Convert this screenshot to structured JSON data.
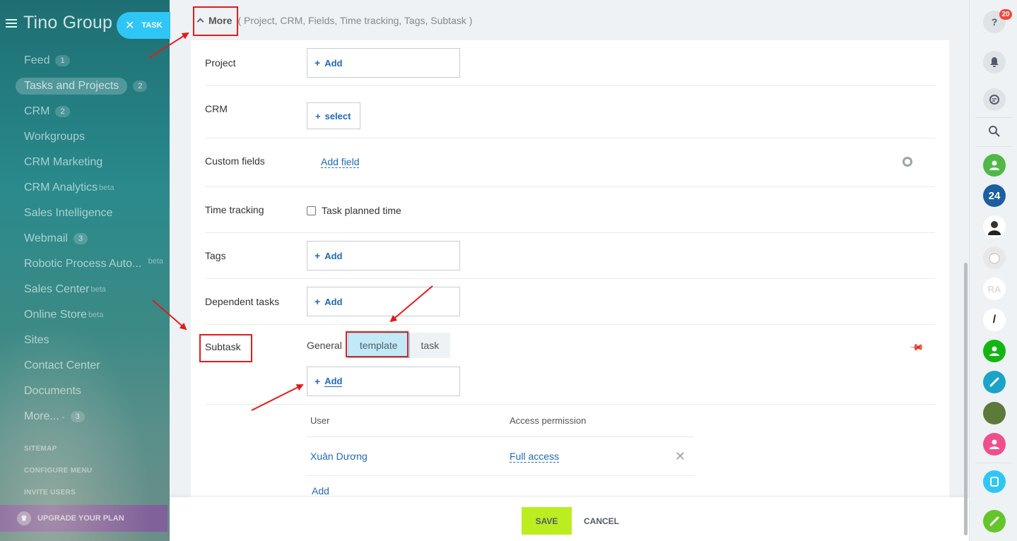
{
  "sidebar": {
    "brand": "Tino Group",
    "task_button": "TASK",
    "items": [
      {
        "label": "Feed",
        "counter": "1"
      },
      {
        "label": "Tasks and Projects",
        "counter": "2"
      },
      {
        "label": "CRM",
        "counter": "2"
      },
      {
        "label": "Workgroups"
      },
      {
        "label": "CRM Marketing"
      },
      {
        "label": "CRM Analytics",
        "beta": "beta"
      },
      {
        "label": "Sales Intelligence"
      },
      {
        "label": "Webmail",
        "counter": "3"
      },
      {
        "label": "Robotic Process Auto...",
        "beta": "beta"
      },
      {
        "label": "Sales Center",
        "beta": "beta"
      },
      {
        "label": "Online Store",
        "beta": "beta"
      },
      {
        "label": "Sites"
      },
      {
        "label": "Contact Center"
      },
      {
        "label": "Documents"
      },
      {
        "label": "More...",
        "suffix": "-",
        "counter": "3"
      }
    ],
    "small_links": [
      "SITEMAP",
      "CONFIGURE MENU",
      "INVITE USERS"
    ],
    "upgrade": "UPGRADE YOUR PLAN"
  },
  "more_section": {
    "toggle_label": "More",
    "hint": "( Project,  CRM,  Fields,  Time tracking,  Tags,  Subtask )"
  },
  "fields": {
    "project": {
      "label": "Project",
      "add": "Add"
    },
    "crm": {
      "label": "CRM",
      "select": "select"
    },
    "custom_fields": {
      "label": "Custom fields",
      "add_field": "Add field"
    },
    "time_tracking": {
      "label": "Time tracking",
      "checkbox_label": "Task planned time"
    },
    "tags": {
      "label": "Tags",
      "add": "Add"
    },
    "dependent": {
      "label": "Dependent tasks",
      "add": "Add"
    },
    "subtask": {
      "label": "Subtask",
      "mode_label": "General",
      "modes": [
        "template",
        "task"
      ],
      "selected": "template",
      "add": "Add"
    }
  },
  "access_table": {
    "headers": [
      "User",
      "Access permission"
    ],
    "rows": [
      {
        "user": "Xuân Dương",
        "permission": "Full access"
      }
    ],
    "add": "Add"
  },
  "footer": {
    "save": "SAVE",
    "cancel": "CANCEL"
  },
  "right_rail": {
    "notifications_count": "20",
    "icons": [
      "help-icon",
      "bell-icon",
      "chat-icon",
      "search-icon",
      "contact-avatar",
      "bitrix24-avatar",
      "person-avatar",
      "cat-avatar",
      "logo-avatar",
      "pen-avatar",
      "contact-avatar-2",
      "phone-avatar",
      "photo-avatar",
      "pink-contact-avatar",
      "dialog-icon",
      "call-icon"
    ],
    "avatar_24_label": "24"
  },
  "colors": {
    "accent": "#2fc6f6",
    "save": "#bbed21",
    "link": "#1f6ab5",
    "annotation": "#e31b1b"
  }
}
